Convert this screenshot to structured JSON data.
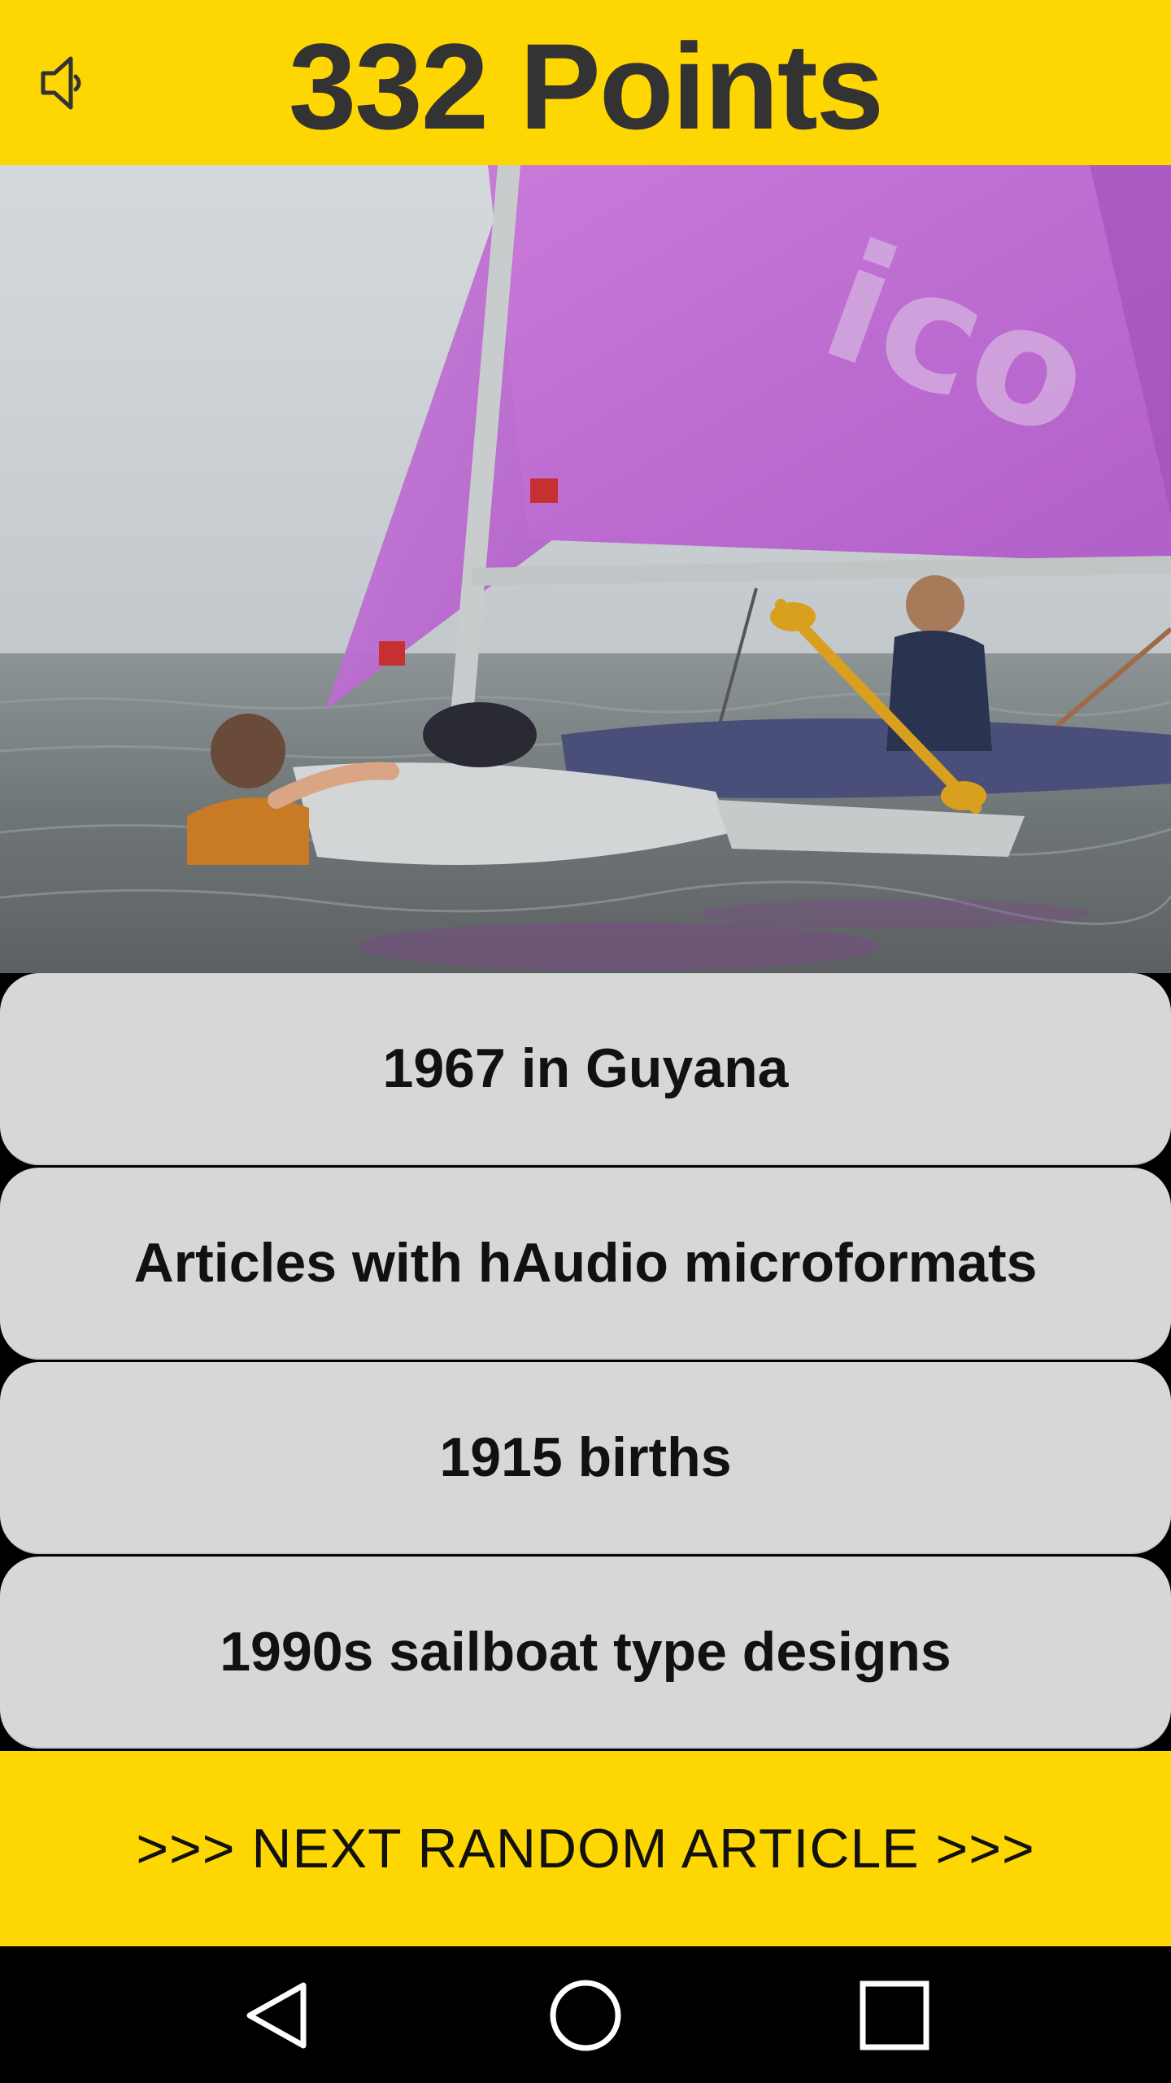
{
  "header": {
    "score_text": "332 Points",
    "sound_icon": "speaker-icon",
    "background_color": "#fed602"
  },
  "photo": {
    "description_icon": "sailboat-photo",
    "sail_text": "ico"
  },
  "options": [
    {
      "label": "1967 in Guyana"
    },
    {
      "label": "Articles with hAudio microformats"
    },
    {
      "label": "1915 births"
    },
    {
      "label": "1990s sailboat type designs"
    }
  ],
  "next_button": {
    "label": ">>> NEXT RANDOM ARTICLE >>>"
  },
  "navbar": {
    "back_icon": "back-triangle-icon",
    "home_icon": "home-circle-icon",
    "recents_icon": "recents-square-icon"
  },
  "colors": {
    "accent": "#fed602",
    "option_bg": "#d6d7d7",
    "text_dark": "#333333"
  }
}
